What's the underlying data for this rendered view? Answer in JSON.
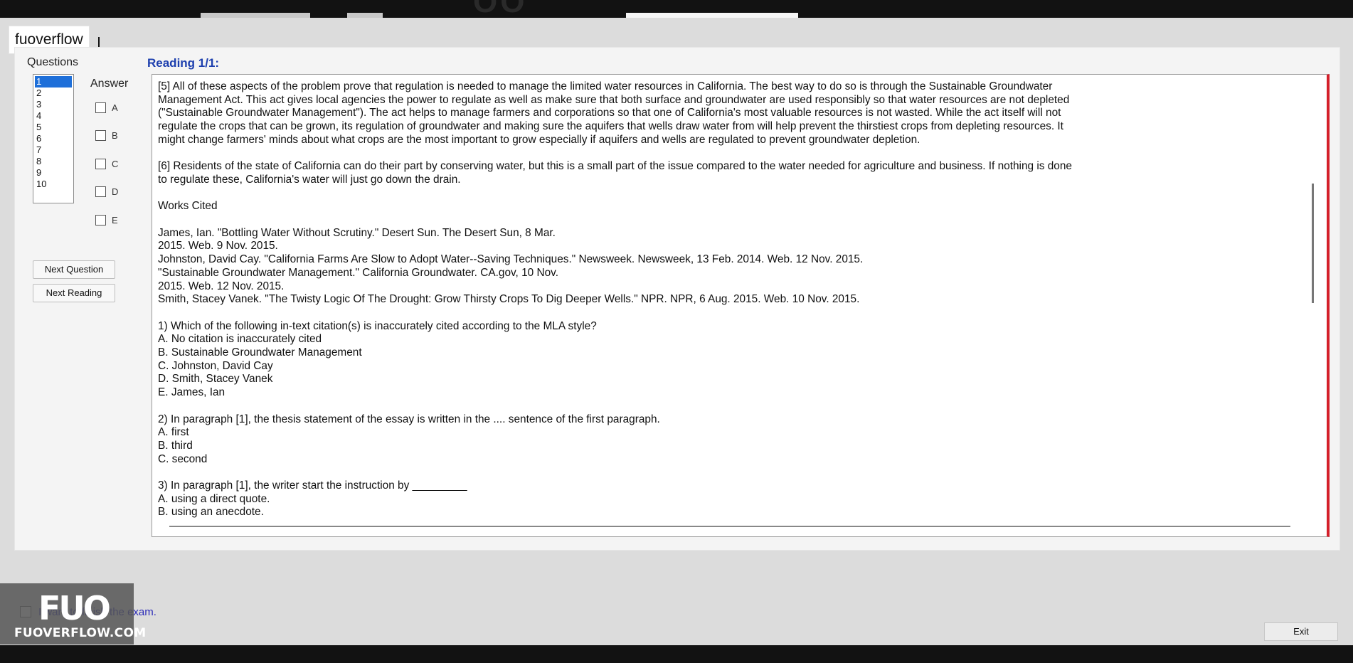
{
  "brand": "fuoverflow",
  "questions_header": "Questions",
  "question_numbers": [
    "1",
    "2",
    "3",
    "4",
    "5",
    "6",
    "7",
    "8",
    "9",
    "10"
  ],
  "answer_header": "Answer",
  "answer_options": [
    "A",
    "B",
    "C",
    "D",
    "E"
  ],
  "buttons": {
    "next_question": "Next Question",
    "next_reading": "Next Reading",
    "exit": "Exit"
  },
  "reading": {
    "title": "Reading 1/1:",
    "p5": "[5] All of these aspects of the problem prove that regulation is needed to manage the limited water resources in California. The best way to do so is through the Sustainable Groundwater\nManagement Act. This act gives local agencies the power to regulate as well as make sure that both surface and groundwater are used responsibly so that water resources are not depleted\n(\"Sustainable Groundwater Management\"). The act helps to manage farmers and corporations so that one of California's most valuable resources is not wasted. While the act itself will not\nregulate the crops that can be grown, its regulation of groundwater and making sure the aquifers that wells draw water from will help prevent the thirstiest crops from depleting resources. It\nmight change farmers' minds about what crops are the most important to grow especially if aquifers and wells are regulated to prevent groundwater depletion.",
    "p6": "[6] Residents of the state of California can do their part by conserving water, but this is a small part of the issue compared to the water needed for agriculture and business. If nothing is done\nto regulate these, California's water will just go down the drain.",
    "works_cited_title": "Works Cited",
    "citations": [
      "James, Ian. \"Bottling Water Without Scrutiny.\" Desert Sun. The Desert Sun, 8 Mar.",
      "2015. Web. 9 Nov. 2015.",
      "Johnston, David Cay. \"California Farms Are Slow to Adopt Water--Saving Techniques.\" Newsweek. Newsweek, 13 Feb. 2014. Web. 12 Nov. 2015.",
      "\"Sustainable Groundwater Management.\" California Groundwater. CA.gov, 10 Nov.",
      "2015. Web. 12 Nov. 2015.",
      "Smith, Stacey Vanek. \"The Twisty Logic Of The Drought: Grow Thirsty Crops To Dig Deeper Wells.\" NPR. NPR, 6 Aug. 2015. Web. 10 Nov. 2015."
    ],
    "q1": [
      "1) Which of the following in-text citation(s) is inaccurately cited according to the MLA style?",
      "A.  No citation is inaccurately cited",
      "B.  Sustainable Groundwater Management",
      "C.  Johnston, David Cay",
      "D.  Smith, Stacey Vanek",
      "E.  James, Ian"
    ],
    "q2": [
      "2) In paragraph [1], the thesis statement of the essay is written in the .... sentence of the first paragraph.",
      "A.  first",
      "B.  third",
      "C.  second"
    ],
    "q3": [
      "3) In paragraph [1], the writer start the instruction by _________",
      "A.  using a direct quote.",
      "B.  using an anecdote."
    ]
  },
  "finish_text": "I want to finish the exam.",
  "logo": {
    "big": "FUO",
    "small": "FUOVERFLOW.COM"
  },
  "colors": {
    "accent": "#1d3fae",
    "selection": "#1e6fd9",
    "scroll_marker": "#d41f2a"
  }
}
